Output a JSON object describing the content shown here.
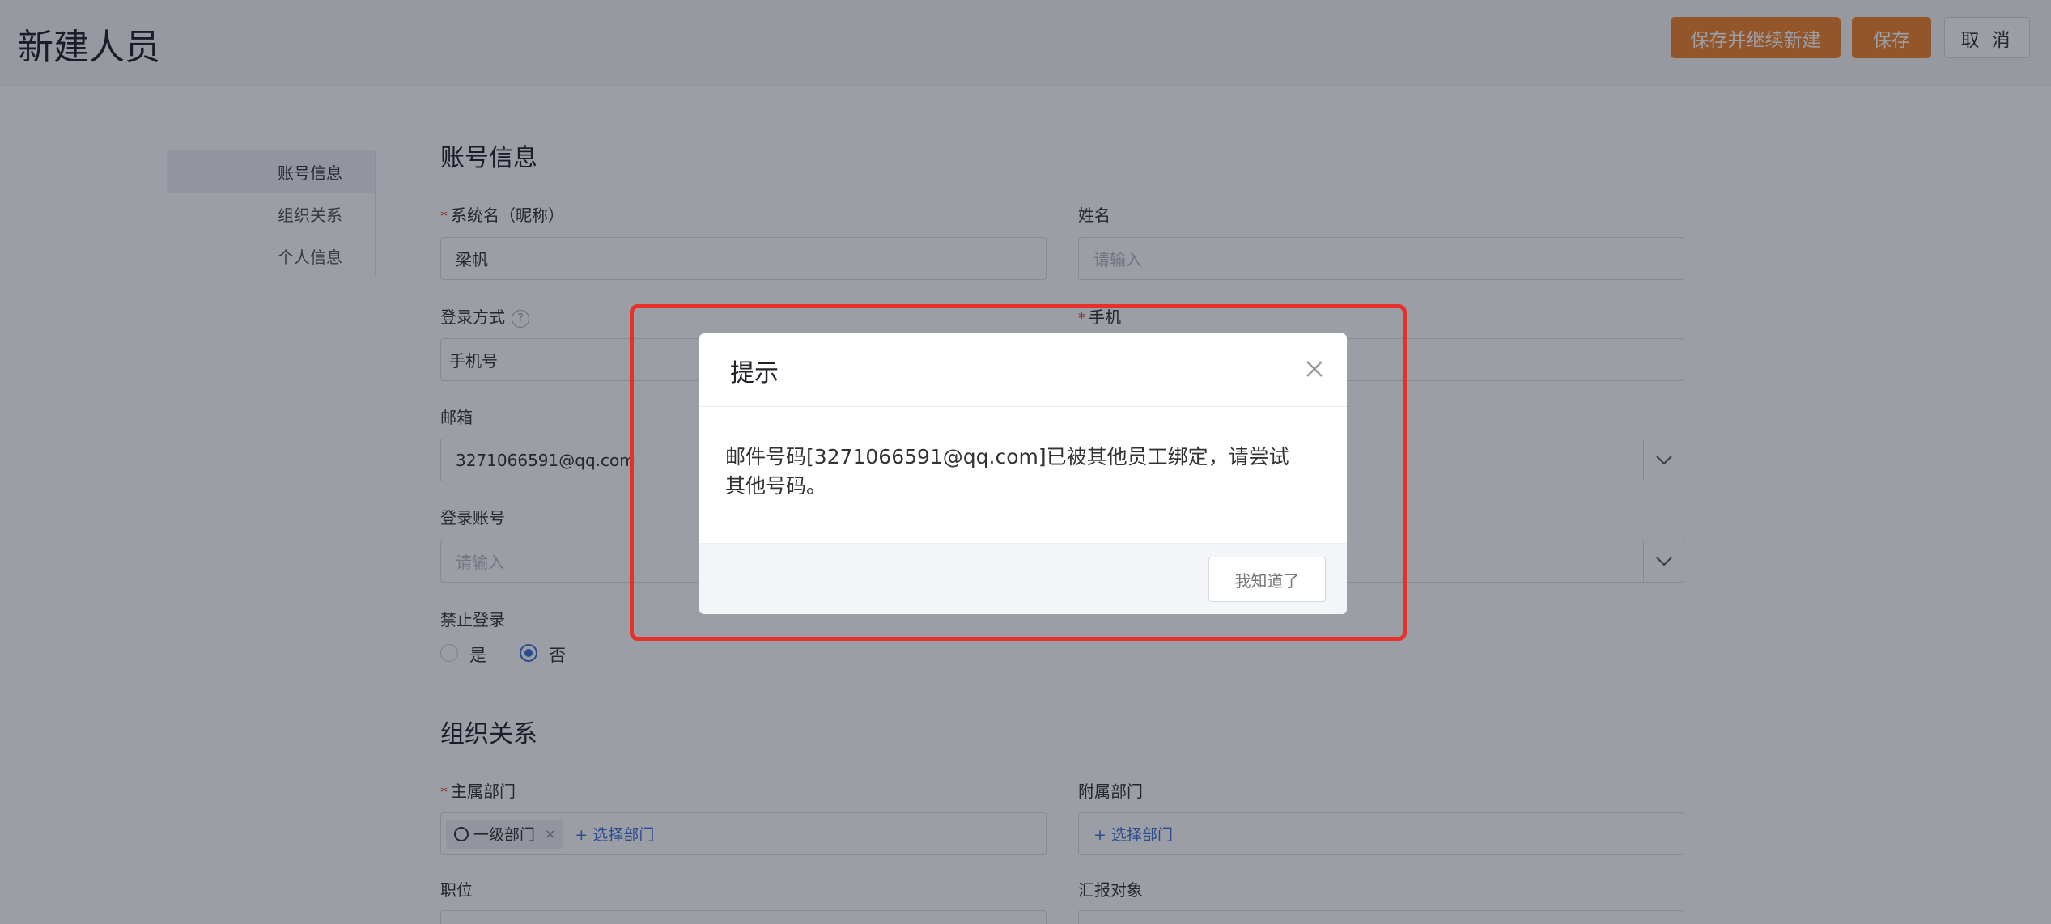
{
  "header": {
    "title": "新建人员",
    "save_continue_label": "保存并继续新建",
    "save_label": "保存",
    "cancel_label": "取 消"
  },
  "nav": {
    "items": [
      {
        "label": "账号信息",
        "active": true
      },
      {
        "label": "组织关系",
        "active": false
      },
      {
        "label": "个人信息",
        "active": false
      }
    ]
  },
  "account": {
    "section_title": "账号信息",
    "system_name_label": "系统名（昵称）",
    "system_name_value": "梁帆",
    "real_name_label": "姓名",
    "real_name_placeholder": "请输入",
    "login_method_label": "登录方式",
    "login_method_help": "?",
    "login_method_value": "手机号",
    "phone_label": "手机",
    "email_label": "邮箱",
    "email_value": "3271066591@qq.com",
    "login_account_label": "登录账号",
    "login_account_placeholder": "请输入",
    "disable_login_label": "禁止登录",
    "disable_yes": "是",
    "disable_no": "否",
    "required_mark": "*"
  },
  "org": {
    "section_title": "组织关系",
    "main_dept_label": "主属部门",
    "main_dept_tag": "一级部门",
    "tag_close": "×",
    "select_dept_link": "+ 选择部门",
    "sub_dept_label": "附属部门",
    "position_label": "职位",
    "report_to_label": "汇报对象"
  },
  "modal": {
    "title": "提示",
    "close": "×",
    "message": "邮件号码[3271066591@qq.com]已被其他员工绑定，请尝试其他号码。",
    "ok_label": "我知道了"
  },
  "colors": {
    "accent": "#f0832b",
    "link": "#3b73d9",
    "highlight": "#e8302a"
  }
}
